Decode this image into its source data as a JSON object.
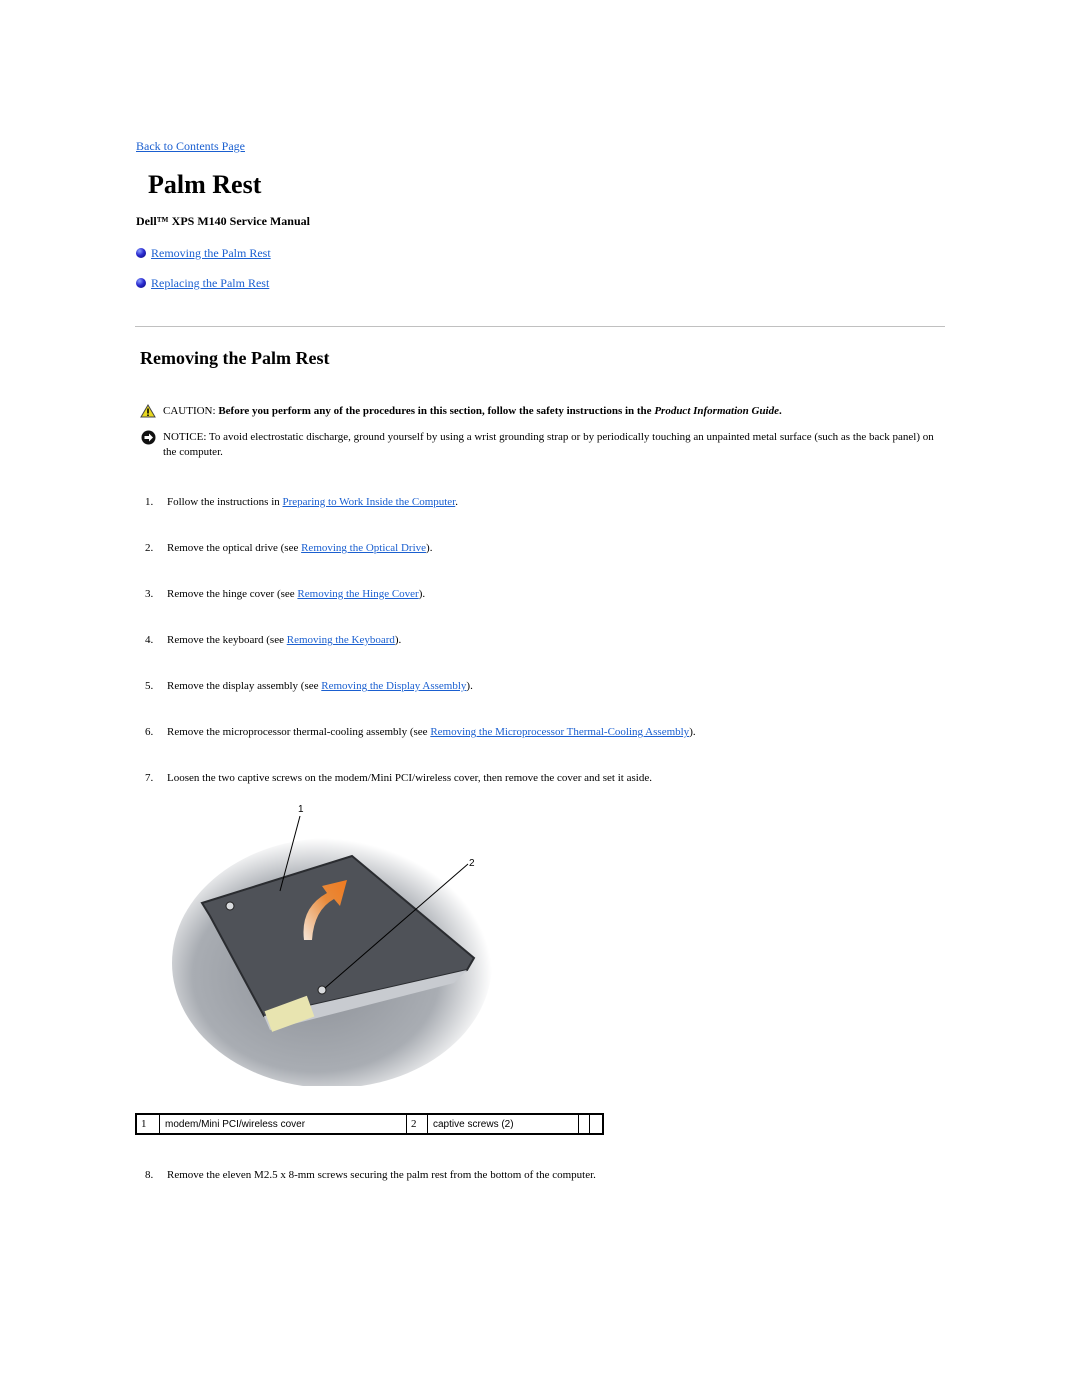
{
  "nav": {
    "back_link": "Back to Contents Page"
  },
  "header": {
    "title": "Palm Rest",
    "manual": "Dell™ XPS M140 Service Manual"
  },
  "toc": [
    {
      "label": "Removing the Palm Rest"
    },
    {
      "label": "Replacing the Palm Rest"
    }
  ],
  "section": {
    "title": "Removing the Palm Rest",
    "caution": {
      "label": "CAUTION: ",
      "text": "Before you perform any of the procedures in this section, follow the safety instructions in the ",
      "guide": "Product Information Guide",
      "end": "."
    },
    "notice": {
      "text": "NOTICE: To avoid electrostatic discharge, ground yourself by using a wrist grounding strap or by periodically touching an unpainted metal surface (such as the back panel) on the computer."
    },
    "steps": [
      {
        "num": "1.",
        "pre": "Follow the instructions in ",
        "link": "Preparing to Work Inside the Computer",
        "post": "."
      },
      {
        "num": "2.",
        "pre": "Remove the optical drive (see ",
        "link": "Removing the Optical Drive",
        "post": ")."
      },
      {
        "num": "3.",
        "pre": "Remove the hinge cover (see ",
        "link": "Removing the Hinge Cover",
        "post": ")."
      },
      {
        "num": "4.",
        "pre": "Remove the keyboard (see ",
        "link": "Removing the Keyboard",
        "post": ")."
      },
      {
        "num": "5.",
        "pre": "Remove the display assembly (see ",
        "link": "Removing the Display Assembly",
        "post": ")."
      },
      {
        "num": "6.",
        "pre": "Remove the microprocessor thermal-cooling assembly (see ",
        "link": "Removing the Microprocessor Thermal-Cooling Assembly",
        "post": ")."
      },
      {
        "num": "7.",
        "pre": "Loosen the two captive screws on the modem/Mini PCI/wireless cover, then remove the cover and set it aside.",
        "link": "",
        "post": ""
      },
      {
        "num": "8.",
        "pre": "Remove the eleven M2.5 x 8-mm screws securing the palm rest from the bottom of the computer.",
        "link": "",
        "post": ""
      }
    ],
    "figure": {
      "callout_1": "1",
      "callout_2": "2"
    },
    "callouts": [
      {
        "num": "1",
        "label": "modem/Mini PCI/wireless cover"
      },
      {
        "num": "2",
        "label": "captive screws (2)"
      }
    ]
  },
  "colors": {
    "link": "#1a5fd0",
    "caution_icon": "#e8d820",
    "rule": "#c0c0c0"
  }
}
